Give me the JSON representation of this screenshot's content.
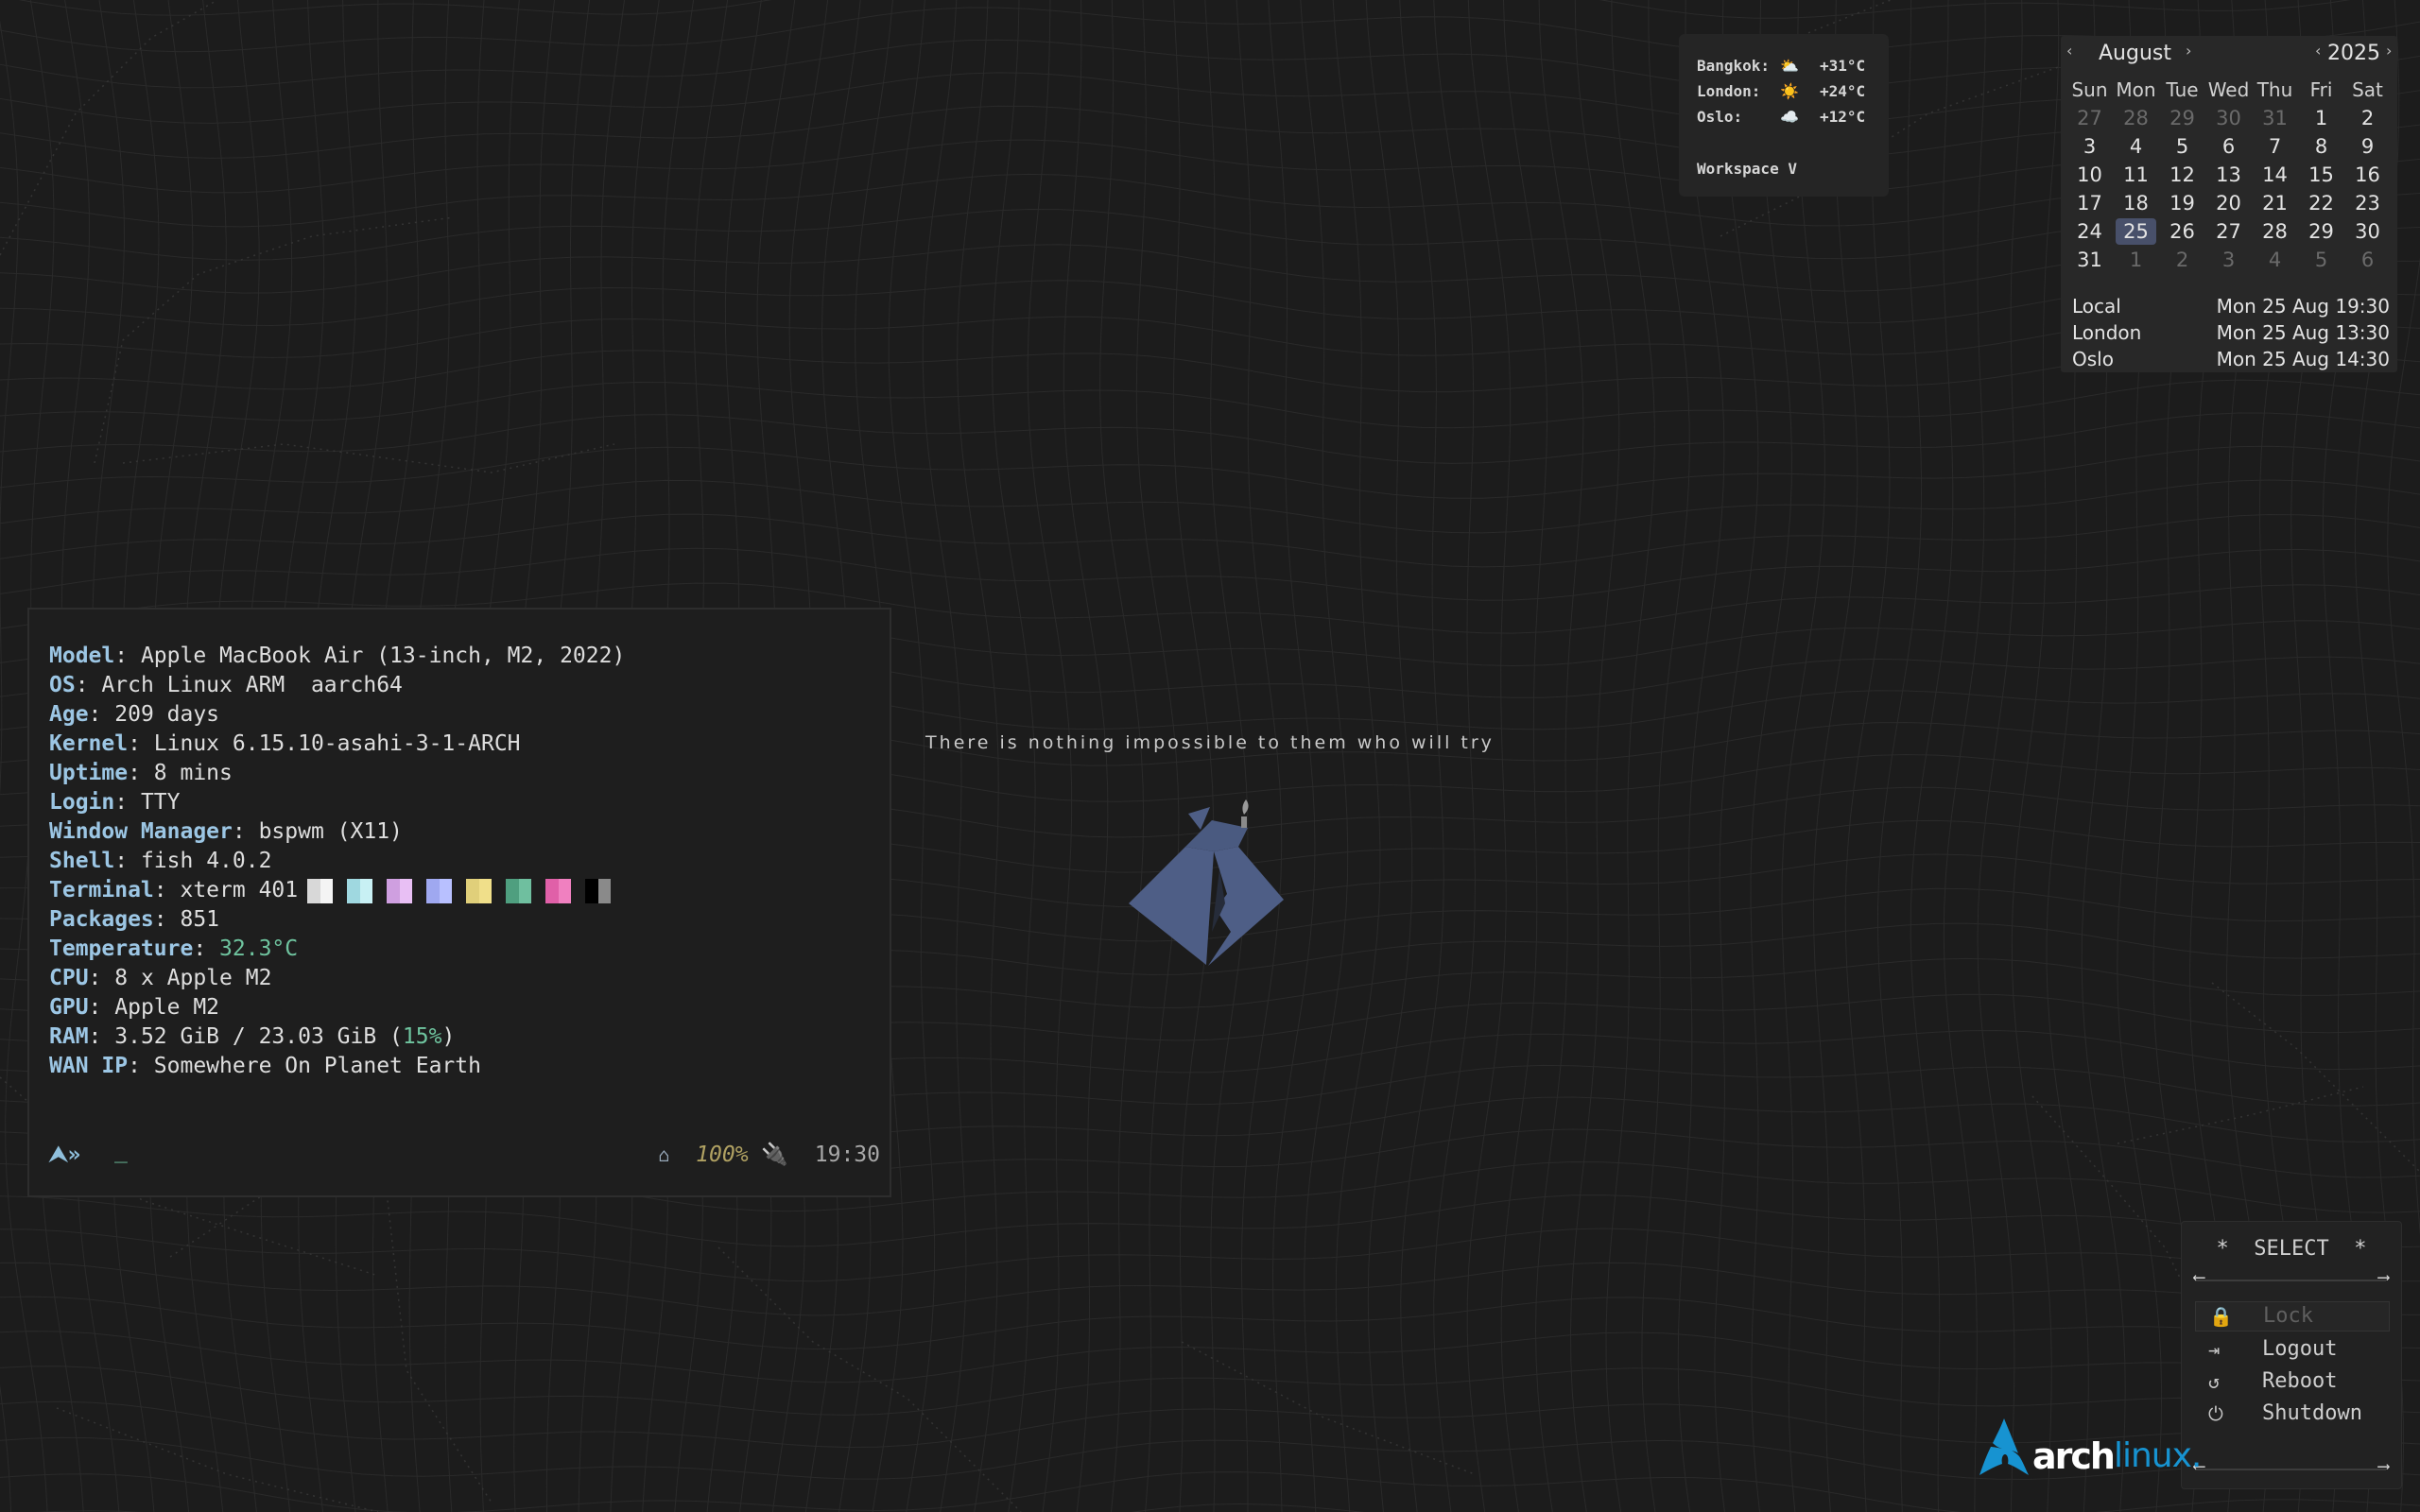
{
  "colors": {
    "background": "#1c1c1c",
    "accent_blue": "#9cc6e4",
    "accent_green": "#6fc49f",
    "arch_blue": "#1793d1",
    "logo_slate": "#4e5e86"
  },
  "weather": {
    "rows": [
      {
        "city": "Bangkok:",
        "icon": "⛅",
        "icon_name": "partly-cloudy-icon",
        "temp": "+31°C"
      },
      {
        "city": "London:",
        "icon": "☀️",
        "icon_name": "sun-icon",
        "temp": "+24°C"
      },
      {
        "city": "Oslo:",
        "icon": "☁️",
        "icon_name": "cloud-icon",
        "temp": "+12°C"
      }
    ],
    "workspace": "Workspace V"
  },
  "calendar": {
    "month": "August",
    "year": "2025",
    "prev": "‹",
    "next": "›",
    "day_names": [
      "Sun",
      "Mon",
      "Tue",
      "Wed",
      "Thu",
      "Fri",
      "Sat"
    ],
    "days": [
      {
        "d": "27",
        "m": true
      },
      {
        "d": "28",
        "m": true
      },
      {
        "d": "29",
        "m": true
      },
      {
        "d": "30",
        "m": true
      },
      {
        "d": "31",
        "m": true
      },
      {
        "d": "1"
      },
      {
        "d": "2"
      },
      {
        "d": "3"
      },
      {
        "d": "4"
      },
      {
        "d": "5"
      },
      {
        "d": "6"
      },
      {
        "d": "7"
      },
      {
        "d": "8"
      },
      {
        "d": "9"
      },
      {
        "d": "10"
      },
      {
        "d": "11"
      },
      {
        "d": "12"
      },
      {
        "d": "13"
      },
      {
        "d": "14"
      },
      {
        "d": "15"
      },
      {
        "d": "16"
      },
      {
        "d": "17"
      },
      {
        "d": "18"
      },
      {
        "d": "19"
      },
      {
        "d": "20"
      },
      {
        "d": "21"
      },
      {
        "d": "22"
      },
      {
        "d": "23"
      },
      {
        "d": "24"
      },
      {
        "d": "25",
        "today": true
      },
      {
        "d": "26"
      },
      {
        "d": "27"
      },
      {
        "d": "28"
      },
      {
        "d": "29"
      },
      {
        "d": "30"
      },
      {
        "d": "31"
      },
      {
        "d": "1",
        "m": true
      },
      {
        "d": "2",
        "m": true
      },
      {
        "d": "3",
        "m": true
      },
      {
        "d": "4",
        "m": true
      },
      {
        "d": "5",
        "m": true
      },
      {
        "d": "6",
        "m": true
      }
    ],
    "clocks": [
      {
        "place": "Local",
        "time": "Mon 25 Aug 19:30"
      },
      {
        "place": "London",
        "time": "Mon 25 Aug 13:30"
      },
      {
        "place": "Oslo",
        "time": "Mon 25 Aug 14:30"
      }
    ]
  },
  "terminal": {
    "lines": [
      {
        "key": "Model",
        "value": "Apple MacBook Air (13-inch, M2, 2022)"
      },
      {
        "key": "OS",
        "value": "Arch Linux ARM  aarch64"
      },
      {
        "key": "Age",
        "value": "209 days"
      },
      {
        "key": "Kernel",
        "value": "Linux 6.15.10-asahi-3-1-ARCH"
      },
      {
        "key": "Uptime",
        "value": "8 mins"
      },
      {
        "key": "Login",
        "value": "TTY"
      },
      {
        "key": "Window Manager",
        "value": "bspwm (X11)"
      },
      {
        "key": "Shell",
        "value": "fish 4.0.2"
      },
      {
        "key": "Terminal",
        "value": "xterm 401"
      },
      {
        "key": "Packages",
        "value": "851"
      },
      {
        "key": "Temperature",
        "value": "32.3°C"
      },
      {
        "key": "CPU",
        "value": "8 x Apple M2"
      },
      {
        "key": "GPU",
        "value": "Apple M2"
      },
      {
        "key": "RAM",
        "value": "3.52 GiB / 23.03 GiB (",
        "highlight": "15%",
        "suffix": ")"
      },
      {
        "key": "WAN IP",
        "value": "Somewhere On Planet Earth"
      }
    ],
    "swatches": [
      [
        "#d8d8d8",
        "#f4f4f4"
      ],
      [
        "#9fd8e0",
        "#c8f0f4"
      ],
      [
        "#cf9fe0",
        "#e8bff4"
      ],
      [
        "#9fa8f0",
        "#b8c0ff"
      ],
      [
        "#e0cf7a",
        "#f0df8a"
      ],
      [
        "#4f9f7f",
        "#6fbf9f"
      ],
      [
        "#e060a8",
        "#f080c0"
      ],
      [
        "#000000",
        "#8a8a8a"
      ]
    ],
    "prompt": "⮝»",
    "cursor": "_",
    "battery": "100%",
    "time": "19:30"
  },
  "quote": "There is nothing impossible to them who will try",
  "power_menu": {
    "title": "*  SELECT  *",
    "items": [
      {
        "label": "Lock",
        "icon": "🔒",
        "icon_name": "lock-icon",
        "selected": true
      },
      {
        "label": "Logout",
        "icon": "⇥",
        "icon_name": "logout-icon"
      },
      {
        "label": "Reboot",
        "icon": "↺",
        "icon_name": "reboot-icon"
      },
      {
        "label": "Shutdown",
        "icon": "⏻",
        "icon_name": "power-icon"
      }
    ]
  },
  "arch_logo": {
    "part1": "arch",
    "part2": "linux."
  }
}
